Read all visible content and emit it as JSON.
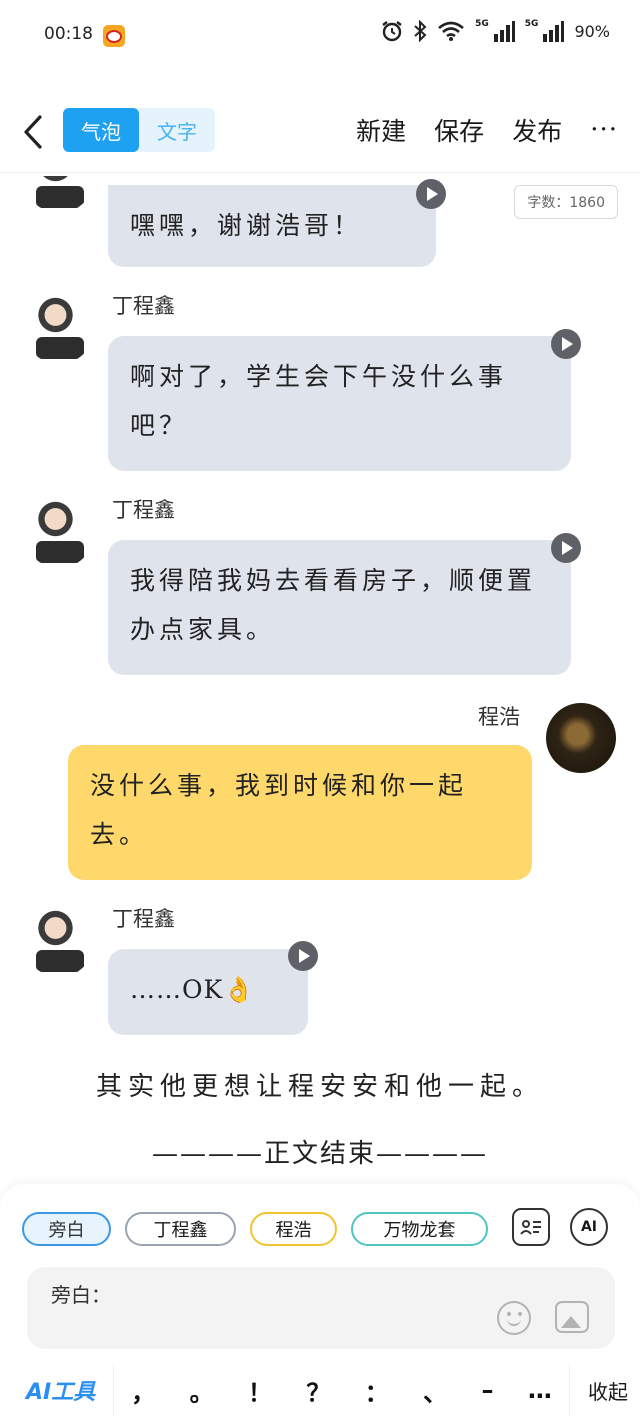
{
  "status_bar": {
    "time": "00:18",
    "battery": "90%",
    "net1": "5G",
    "net2": "5G"
  },
  "header": {
    "toggle_active": "气泡",
    "toggle_inactive": "文字",
    "new": "新建",
    "save": "保存",
    "publish": "发布",
    "more": "···"
  },
  "word_count": "字数：1860",
  "messages": [
    {
      "text": "嘿嘿，谢谢浩哥！"
    },
    {
      "name": "丁程鑫",
      "text": "啊对了，学生会下午没什么事吧？"
    },
    {
      "name": "丁程鑫",
      "text": "我得陪我妈去看看房子，顺便置办点家具。"
    },
    {
      "name": "程浩",
      "text": "没什么事，我到时候和你一起去。"
    },
    {
      "name": "丁程鑫",
      "text": "……OK👌"
    }
  ],
  "narration": {
    "line1": "其实他更想让程安安和他一起。",
    "line2": "————正文结束————"
  },
  "chips": [
    "旁白",
    "丁程鑫",
    "程浩",
    "万物龙套"
  ],
  "ai_button": "AI",
  "input": {
    "prefix": "旁白："
  },
  "toolbar": {
    "ai_tools": "AI工具",
    "punctuation": [
      "，",
      "。",
      "！",
      "？",
      "：",
      "、",
      "–",
      "…"
    ],
    "collapse": "收起"
  }
}
